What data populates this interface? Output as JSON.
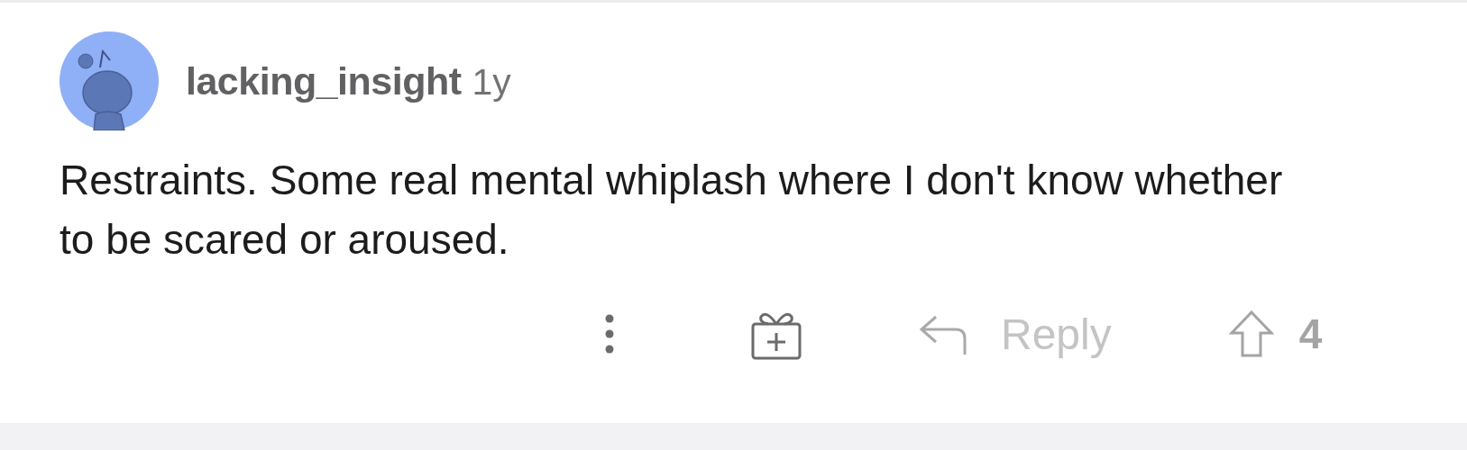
{
  "comment": {
    "author": "lacking_insight",
    "age": "1y",
    "body": "Restraints. Some real mental whiplash where I don't know whether to be scared or aroused.",
    "actions": {
      "reply": {
        "label": "Reply",
        "disabled": true
      },
      "votes": "4"
    }
  }
}
